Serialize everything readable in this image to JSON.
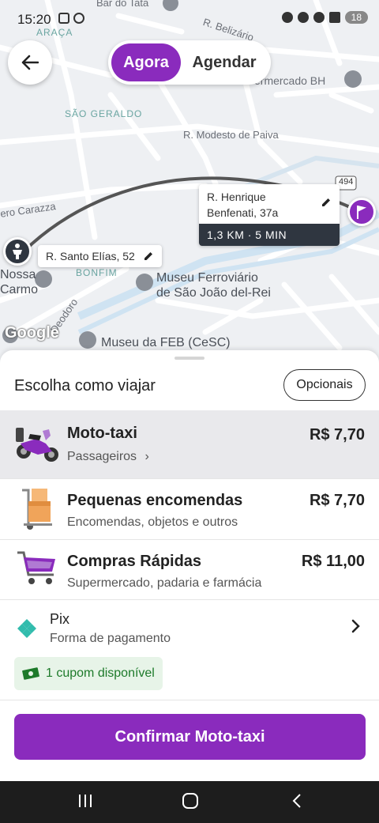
{
  "status_bar": {
    "time": "15:20",
    "battery": "18"
  },
  "toggle": {
    "now_label": "Agora",
    "schedule_label": "Agendar"
  },
  "map": {
    "labels": {
      "bar": "Bar do Tata",
      "araca": "ARAÇA",
      "belizario": "R. Belizário",
      "supermercado": "ermercado BH",
      "sao_geraldo": "SÃO GERALDO",
      "modesto": "R. Modesto de Paiva",
      "carazza": "ero Carazza",
      "bonfim": "BONFIM",
      "museu_ferroviario_1": "Museu Ferroviário",
      "museu_ferroviario_2": "de São João del-Rei",
      "nossa": "Nossa",
      "carmo": "Carmo",
      "deodoro": "Deodoro",
      "museu_feb": "Museu da FEB (CeSC)",
      "route_494": "494",
      "google": "Google"
    },
    "origin_address": "R. Santo Elías, 52",
    "destination_address_line1": "R. Henrique",
    "destination_address_line2": "Benfenati, 37a",
    "eta": "1,3 KM · 5 MIN"
  },
  "sheet": {
    "title": "Escolha como viajar",
    "optionals_label": "Opcionais",
    "options": [
      {
        "name": "Moto-taxi",
        "subtitle": "Passageiros",
        "price": "R$ 7,70"
      },
      {
        "name": "Pequenas encomendas",
        "subtitle": "Encomendas, objetos e outros",
        "price": "R$ 7,70"
      },
      {
        "name": "Compras Rápidas",
        "subtitle": "Supermercado, padaria e farmácia",
        "price": "R$ 11,00"
      }
    ],
    "payment": {
      "name": "Pix",
      "subtitle": "Forma de pagamento"
    },
    "coupon": "1 cupom disponível",
    "confirm_label": "Confirmar Moto-taxi"
  },
  "colors": {
    "accent": "#8a2bbd",
    "dark": "#2f3640",
    "coupon_bg": "#e7f4e8",
    "coupon_text": "#1d7a2a",
    "pix": "#32bcad"
  }
}
